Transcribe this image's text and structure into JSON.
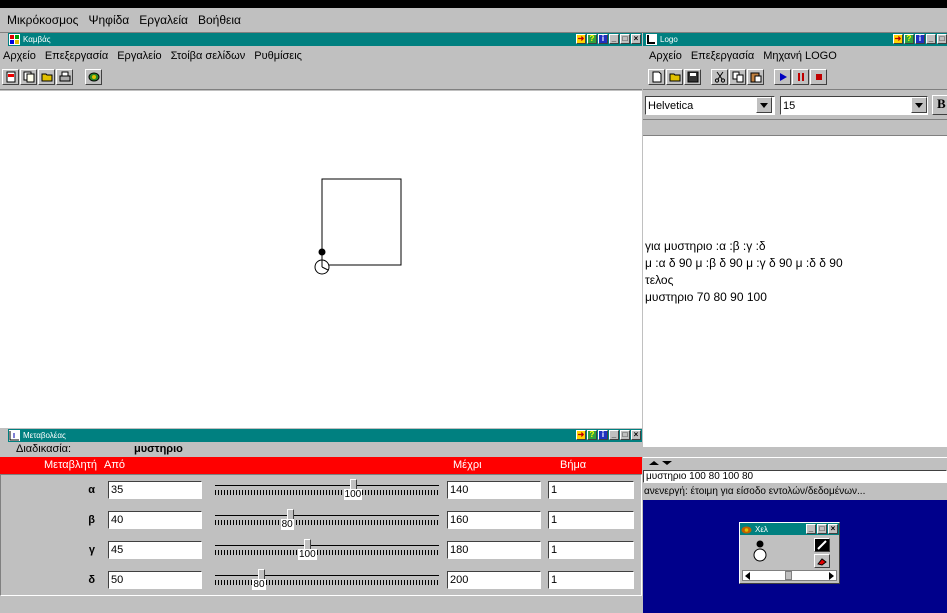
{
  "app_menu": [
    "Μικρόκοσμος",
    "Ψηφίδα",
    "Εργαλεία",
    "Βοήθεια"
  ],
  "canvas_window": {
    "title": "Καμβάς",
    "menu": [
      "Αρχείο",
      "Επεξεργασία",
      "Εργαλείο",
      "Στοίβα σελίδων",
      "Ρυθμίσεις"
    ],
    "toolbar_icons": [
      "new-page-icon",
      "duplicate-page-icon",
      "open-folder-icon",
      "print-icon",
      "turtle-tool-icon"
    ]
  },
  "logo_window": {
    "title": "Logo",
    "menu": [
      "Αρχείο",
      "Επεξεργασία",
      "Μηχανή LOGO"
    ],
    "toolbar_icons": [
      "new-file-icon",
      "open-folder-icon",
      "save-icon",
      "cut-icon",
      "copy-icon",
      "paste-icon",
      "play-icon",
      "pause-icon",
      "stop-icon"
    ],
    "font_name": "Helvetica",
    "font_size": "15",
    "bold_label": "B",
    "editor_lines": [
      "για μυστηριο :α :β :γ :δ",
      "μ :α δ 90 μ :β δ 90 μ :γ δ 90 μ :δ δ 90",
      "τελος",
      "μυστηριο 70 80 90 100"
    ],
    "command_line": "μυστηριο 100 80 100 80",
    "status": "ανενεργή: έτοιμη για είσοδο εντολών/δεδομένων..."
  },
  "variables_window": {
    "title": "Μεταβολέας",
    "procedure_label": "Διαδικασία:",
    "procedure_name": "μυστηριο",
    "headers": {
      "variable": "Μεταβλητή",
      "from": "Από",
      "to": "Μέχρι",
      "step": "Βήμα"
    },
    "rows": [
      {
        "name": "α",
        "from": "35",
        "to": "140",
        "step": "1",
        "value": "100",
        "level": 0.62
      },
      {
        "name": "β",
        "from": "40",
        "to": "160",
        "step": "1",
        "value": "80",
        "level": 0.33
      },
      {
        "name": "γ",
        "from": "45",
        "to": "180",
        "step": "1",
        "value": "100",
        "level": 0.41
      },
      {
        "name": "δ",
        "from": "50",
        "to": "200",
        "step": "1",
        "value": "80",
        "level": 0.2
      }
    ]
  },
  "turtle_window": {
    "title": "Χελ"
  },
  "colors": {
    "title_bar": "#008080",
    "header_red": "#ff0000",
    "console_blue": "#00008b",
    "window_gray": "#c0c0c0"
  }
}
